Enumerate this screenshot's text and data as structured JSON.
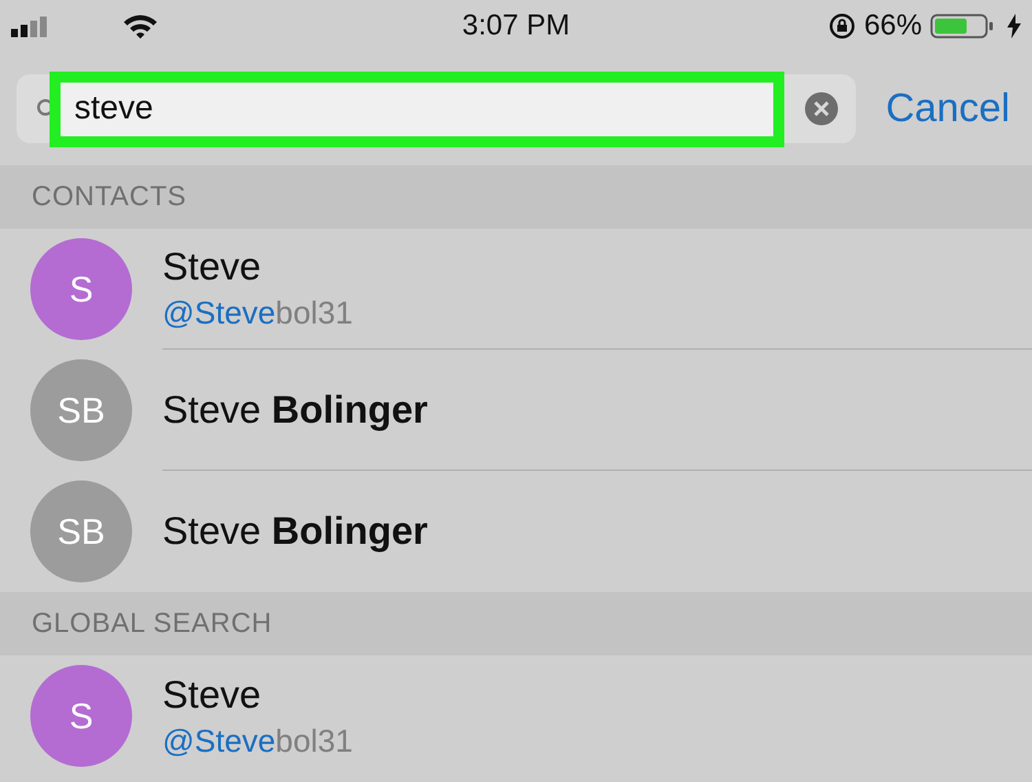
{
  "status_bar": {
    "time": "3:07 PM",
    "battery": "66%"
  },
  "search": {
    "value": "steve",
    "highlighted": true,
    "cancel": "Cancel"
  },
  "sections": [
    {
      "title": "CONTACTS",
      "rows": [
        {
          "initials": "S",
          "color": "#b46cd2",
          "name": "Steve",
          "username_match": "@Steve",
          "username_rest": "bol31"
        },
        {
          "initials": "SB",
          "color": "#9c9c9c",
          "name": "Steve **Bolinger**"
        },
        {
          "initials": "SB",
          "color": "#9c9c9c",
          "name": "Steve **Bolinger**"
        }
      ]
    },
    {
      "title": "GLOBAL SEARCH",
      "rows": [
        {
          "initials": "S",
          "color": "#b46cd2",
          "name": "Steve",
          "username_match": "@Steve",
          "username_rest": "bol31"
        }
      ]
    }
  ]
}
